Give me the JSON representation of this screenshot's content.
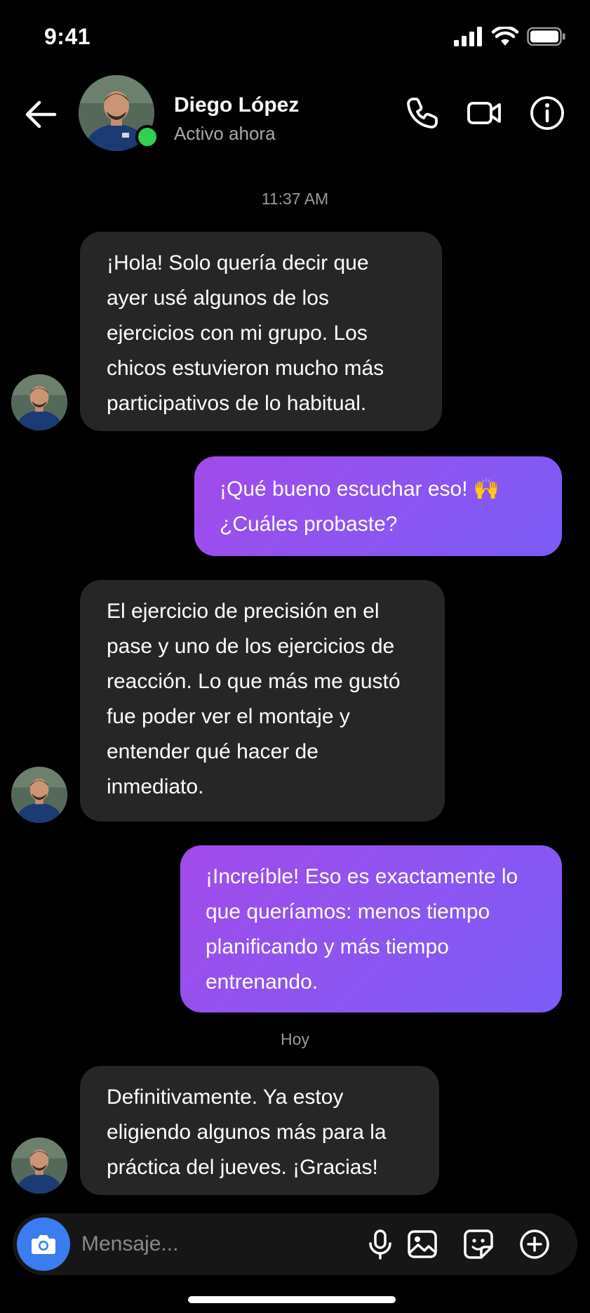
{
  "status_bar": {
    "time": "9:41"
  },
  "header": {
    "contact_name": "Diego López",
    "contact_status": "Activo ahora",
    "icons": [
      "back-arrow-icon",
      "phone-icon",
      "video-camera-icon",
      "info-icon"
    ]
  },
  "messages": [
    {
      "type": "timestamp",
      "text": "11:37 AM"
    },
    {
      "type": "incoming",
      "text": "¡Hola! Solo quería decir que ayer usé algunos de los ejercicios con mi grupo. Los chicos estuvieron mucho más participativos de lo habitual."
    },
    {
      "type": "outgoing",
      "text": "¡Qué bueno escuchar eso! 🙌 ¿Cuáles probaste?"
    },
    {
      "type": "incoming",
      "text": "El ejercicio de precisión en el pase y uno de los ejercicios de reacción. Lo que más me gustó fue poder ver el montaje y entender qué hacer de inmediato."
    },
    {
      "type": "outgoing",
      "text": "¡Increíble! Eso es exactamente lo que queríamos: menos tiempo planificando y más tiempo entrenando."
    },
    {
      "type": "timestamp",
      "text": "Hoy"
    },
    {
      "type": "incoming",
      "text": "Definitivamente. Ya estoy eligiendo algunos más para la práctica del jueves. ¡Gracias!"
    }
  ],
  "composer": {
    "placeholder": "Mensaje...",
    "icons": [
      "camera-icon",
      "microphone-icon",
      "image-icon",
      "sticker-icon",
      "plus-circle-icon"
    ]
  },
  "colors": {
    "background": "#000000",
    "incoming_bubble": "#262626",
    "outgoing_gradient_start": "#a24bea",
    "outgoing_gradient_end": "#7b5cf6",
    "online": "#31d04e",
    "camera_button": "#3b7cf0"
  }
}
